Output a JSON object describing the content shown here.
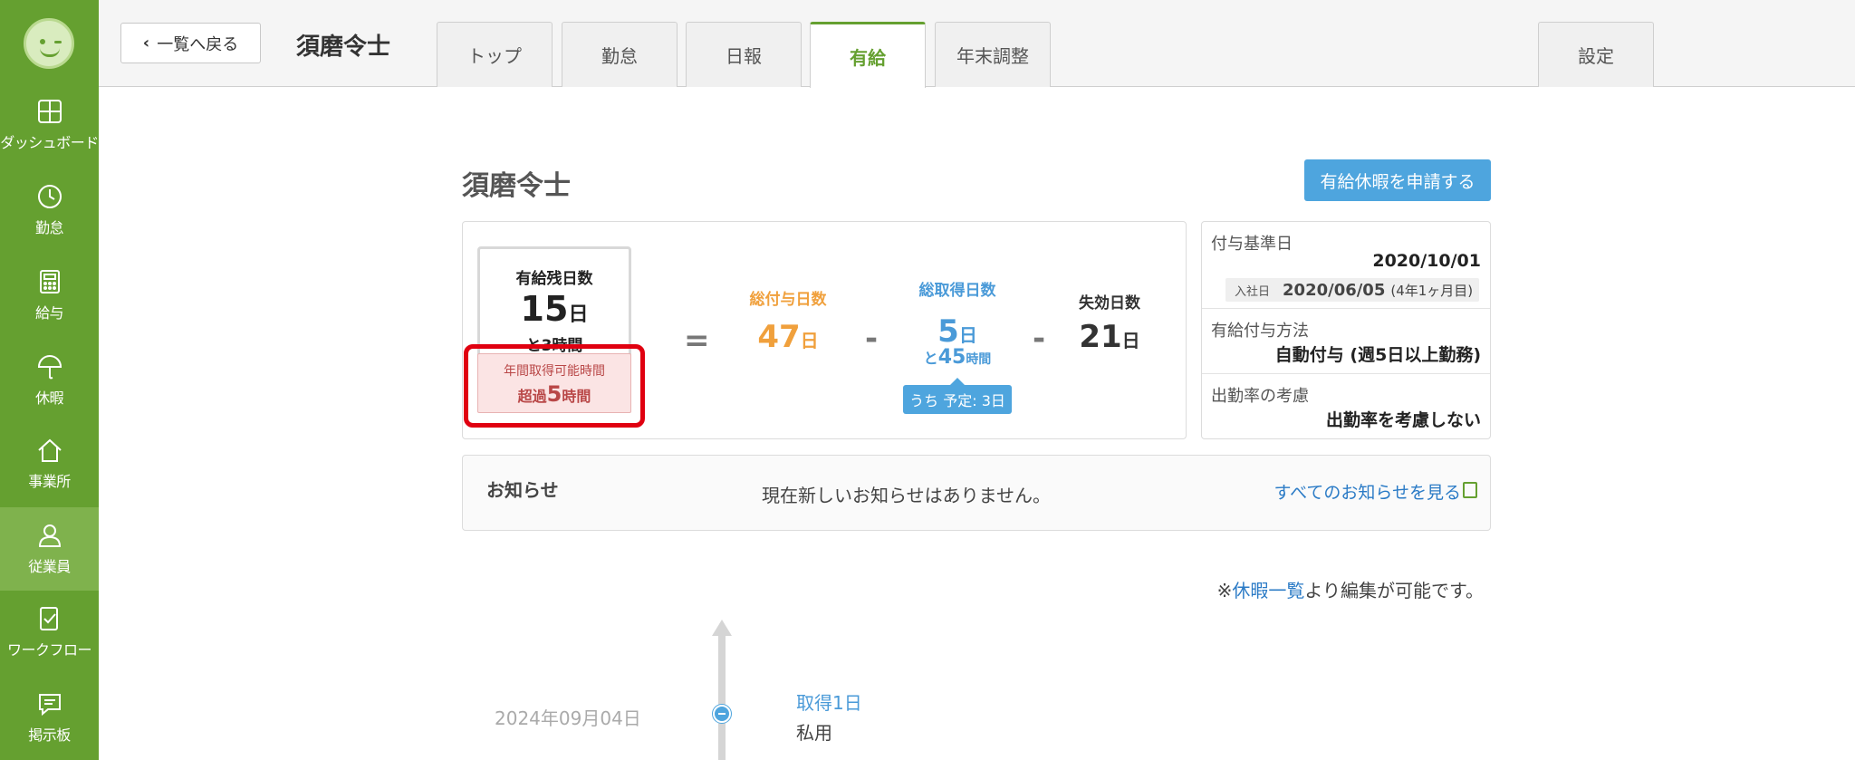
{
  "sidebar": {
    "items": [
      {
        "label": "ダッシュボード",
        "icon": "dashboard-icon"
      },
      {
        "label": "勤怠",
        "icon": "clock-icon"
      },
      {
        "label": "給与",
        "icon": "calculator-icon"
      },
      {
        "label": "休暇",
        "icon": "umbrella-icon"
      },
      {
        "label": "事業所",
        "icon": "home-icon"
      },
      {
        "label": "従業員",
        "icon": "person-icon"
      },
      {
        "label": "ワークフロー",
        "icon": "checklist-icon"
      },
      {
        "label": "掲示板",
        "icon": "chat-icon"
      }
    ],
    "active_index": 5
  },
  "header": {
    "back_label": "一覧へ戻る",
    "employee_name": "須磨令士",
    "tabs": [
      "トップ",
      "勤怠",
      "日報",
      "有給",
      "年末調整"
    ],
    "active_tab": "有給",
    "settings_label": "設定"
  },
  "main": {
    "name": "須磨令士",
    "apply_label": "有給休暇を申請する",
    "remain": {
      "title": "有給残日数",
      "value": "15",
      "unit": "日",
      "sub": "と3時間"
    },
    "annual": {
      "title": "年間取得可能時間",
      "prefix": "超過",
      "value": "5",
      "unit": "時間"
    },
    "equals": "=",
    "minus": "-",
    "granted": {
      "label": "総付与日数",
      "value": "47",
      "unit": "日"
    },
    "taken": {
      "label": "総取得日数",
      "value": "5",
      "unit": "日",
      "extra_prefix": "と",
      "extra_value": "45",
      "extra_unit": "時間",
      "badge": "うち 予定: 3日"
    },
    "expired": {
      "label": "失効日数",
      "value": "21",
      "unit": "日"
    },
    "info": {
      "base_date_label": "付与基準日",
      "base_date": "2020/10/01",
      "hire_label": "入社日",
      "hire_date": "2020/06/05",
      "hire_span": "(4年1ヶ月目)",
      "method_label": "有給付与方法",
      "method_value": "自動付与 (週5日以上勤務)",
      "attendance_label": "出勤率の考慮",
      "attendance_value": "出勤率を考慮しない"
    },
    "notice": {
      "title": "お知らせ",
      "message": "現在新しいお知らせはありません。",
      "link": "すべてのお知らせを見る"
    },
    "edit_note_prefix": "※",
    "edit_note_link": "休暇一覧",
    "edit_note_suffix": "より編集が可能です。",
    "timeline": [
      {
        "date": "2024年09月04日",
        "title": "取得1日",
        "reason": "私用"
      }
    ]
  },
  "colors": {
    "sidebar": "#65a030",
    "accent_blue": "#4ea5de",
    "orange": "#f0a03c",
    "warning": "#e00010"
  }
}
